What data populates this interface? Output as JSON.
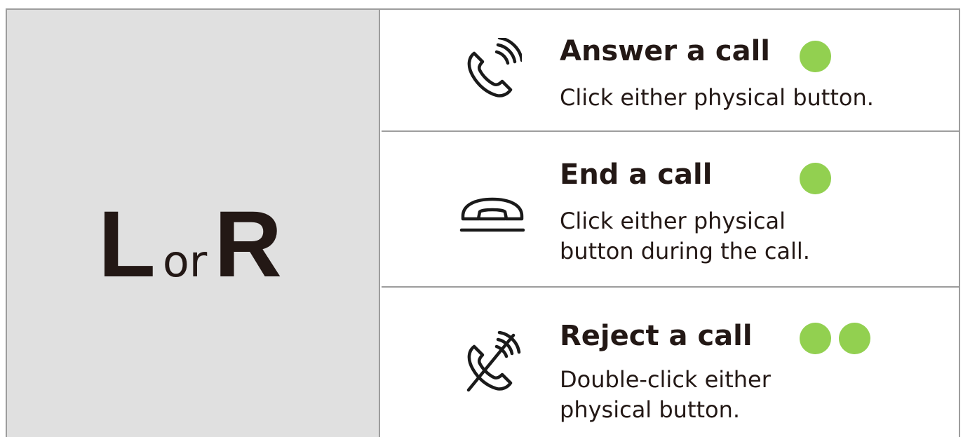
{
  "key": {
    "left": "L",
    "connector": "or",
    "right": "R"
  },
  "colors": {
    "dot": "#92d050",
    "border": "#9d9d9d",
    "panel": "#e0e0e0",
    "text": "#231815"
  },
  "rows": [
    {
      "title": "Answer a call",
      "description": "Click either physical button.",
      "icon": "phone-ringing-icon",
      "clicks": 1
    },
    {
      "title": "End a call",
      "description": "Click either physical button during the call.",
      "icon": "phone-hangup-icon",
      "clicks": 1
    },
    {
      "title": "Reject a call",
      "description": "Double-click either physical button.",
      "icon": "phone-reject-icon",
      "clicks": 2
    }
  ]
}
